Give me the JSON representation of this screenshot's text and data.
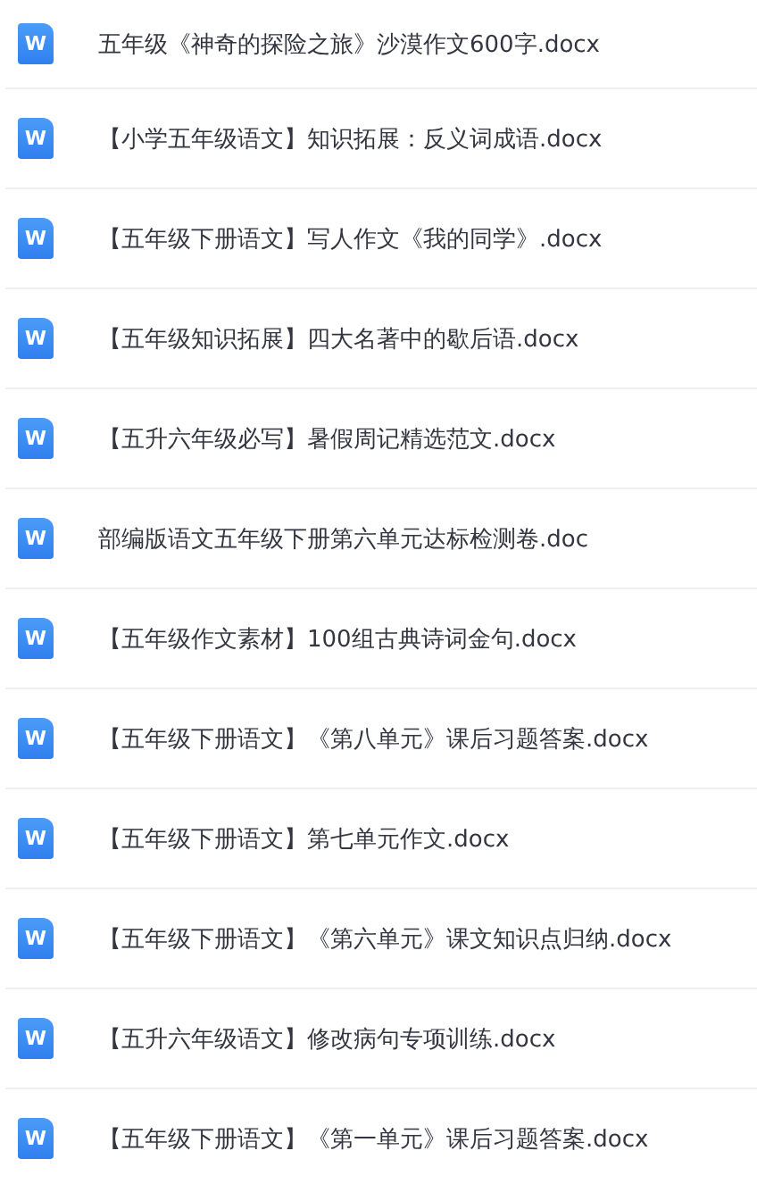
{
  "files": [
    {
      "icon_text": "W",
      "name": "五年级《神奇的探险之旅》沙漠作文600字.docx"
    },
    {
      "icon_text": "W",
      "name": "【小学五年级语文】知识拓展：反义词成语.docx"
    },
    {
      "icon_text": "W",
      "name": "【五年级下册语文】写人作文《我的同学》.docx"
    },
    {
      "icon_text": "W",
      "name": "【五年级知识拓展】四大名著中的歇后语.docx"
    },
    {
      "icon_text": "W",
      "name": "【五升六年级必写】暑假周记精选范文.docx"
    },
    {
      "icon_text": "W",
      "name": "部编版语文五年级下册第六单元达标检测卷.doc"
    },
    {
      "icon_text": "W",
      "name": "【五年级作文素材】100组古典诗词金句.docx"
    },
    {
      "icon_text": "W",
      "name": "【五年级下册语文】《第八单元》课后习题答案.docx"
    },
    {
      "icon_text": "W",
      "name": "【五年级下册语文】第七单元作文.docx"
    },
    {
      "icon_text": "W",
      "name": "【五年级下册语文】《第六单元》课文知识点归纳.docx"
    },
    {
      "icon_text": "W",
      "name": "【五升六年级语文】修改病句专项训练.docx"
    },
    {
      "icon_text": "W",
      "name": "【五年级下册语文】《第一单元》课后习题答案.docx"
    }
  ]
}
